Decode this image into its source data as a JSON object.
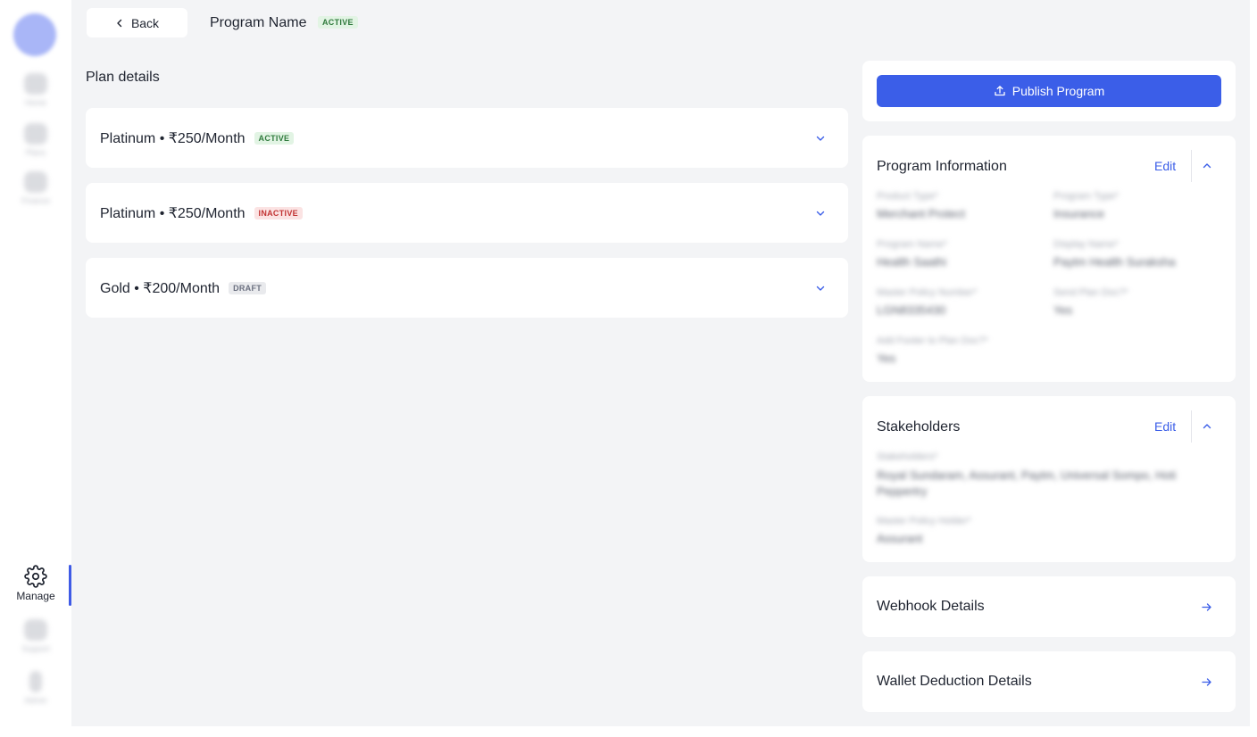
{
  "sidebar": {
    "items_blurred": [
      "Home",
      "Plans",
      "Finance"
    ],
    "manage_label": "Manage",
    "items_blurred_bottom": [
      "Support",
      "Admin"
    ]
  },
  "header": {
    "back_label": "Back",
    "program_name": "Program Name",
    "status": "ACTIVE"
  },
  "plans": {
    "section_title": "Plan details",
    "items": [
      {
        "title": "Platinum • ₹250/Month",
        "status": "ACTIVE"
      },
      {
        "title": "Platinum • ₹250/Month",
        "status": "INACTIVE"
      },
      {
        "title": "Gold • ₹200/Month",
        "status": "DRAFT"
      }
    ]
  },
  "right_panel": {
    "publish_label": "Publish Program",
    "program_info": {
      "title": "Program Information",
      "edit_label": "Edit",
      "fields": [
        {
          "label": "Product Type*",
          "value": "Merchant Protect"
        },
        {
          "label": "Program Type*",
          "value": "Insurance"
        },
        {
          "label": "Program Name*",
          "value": "Health Saathi"
        },
        {
          "label": "Display Name*",
          "value": "Paytm Health Suraksha"
        },
        {
          "label": "Master Policy Number*",
          "value": "LGN8335430"
        },
        {
          "label": "Send Plan Doc?*",
          "value": "Yes"
        },
        {
          "label": "Add Footer to Plan Doc?*",
          "value": "Yes"
        }
      ]
    },
    "stakeholders": {
      "title": "Stakeholders",
      "edit_label": "Edit",
      "fields": [
        {
          "label": "Stakeholders*",
          "value": "Royal Sundaram, Assurant, Paytm, Universal Sompo, Hoti Peppertry"
        },
        {
          "label": "Master Policy Holder*",
          "value": "Assurant"
        }
      ]
    },
    "webhook": {
      "title": "Webhook Details"
    },
    "wallet": {
      "title": "Wallet Deduction Details"
    }
  },
  "colors": {
    "accent": "#3b5ee8",
    "active_badge": "#e2f4e4",
    "inactive_badge": "#fbe3e3",
    "draft_badge": "#e9eaed",
    "background": "#f3f4f6"
  },
  "icons": [
    "chevron-left-icon",
    "chevron-down-icon",
    "chevron-up-icon",
    "upload-icon",
    "arrow-right-icon",
    "gear-icon"
  ]
}
